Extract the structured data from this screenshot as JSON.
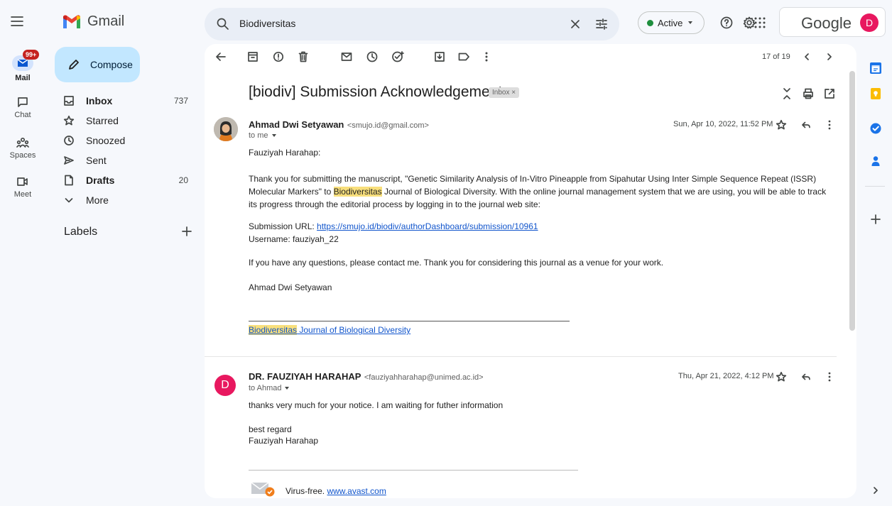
{
  "app": {
    "name": "Gmail"
  },
  "search": {
    "query": "Biodiversitas"
  },
  "status": {
    "label": "Active"
  },
  "account": {
    "brand": "Google",
    "initial": "D"
  },
  "rail": {
    "badge": "99+",
    "items": [
      {
        "label": "Mail"
      },
      {
        "label": "Chat"
      },
      {
        "label": "Spaces"
      },
      {
        "label": "Meet"
      }
    ]
  },
  "sidebar": {
    "compose": "Compose",
    "items": [
      {
        "label": "Inbox",
        "count": "737"
      },
      {
        "label": "Starred",
        "count": ""
      },
      {
        "label": "Snoozed",
        "count": ""
      },
      {
        "label": "Sent",
        "count": ""
      },
      {
        "label": "Drafts",
        "count": "20"
      },
      {
        "label": "More",
        "count": ""
      }
    ],
    "labels_title": "Labels"
  },
  "toolbar": {
    "page_count": "17 of 19"
  },
  "thread": {
    "subject": "[biodiv] Submission Acknowledgement",
    "chip": "Inbox ×",
    "messages": [
      {
        "sender": "Ahmad Dwi Setyawan",
        "email": "<smujo.id@gmail.com>",
        "to": "to me",
        "date": "Sun, Apr 10, 2022, 11:52 PM",
        "greeting": "Fauziyah Harahap:",
        "p1_before": "Thank you for submitting the manuscript, \"Genetic Similarity Analysis of In-Vitro Pineapple from Sipahutar Using Inter Simple Sequence Repeat (ISSR) Molecular Markers\" to ",
        "p1_highlight": "Biodiversitas",
        "p1_after": " Journal of Biological Diversity. With the online journal management system that we are using, you will be able to track its progress through the editorial process by logging in to the journal web site:",
        "url_label": "Submission URL: ",
        "url": "https://smujo.id/biodiv/authorDashboard/submission/10961",
        "username": "Username: fauziyah_22",
        "p2": "If you have any questions, please contact me. Thank you for considering this journal as a venue for your work.",
        "signoff": "Ahmad Dwi Setyawan",
        "footer_highlight": "Biodiversitas",
        "footer_link": " Journal of Biological Diversity"
      },
      {
        "sender": "DR. FAUZIYAH HARAHAP",
        "email": "<fauziyahharahap@unimed.ac.id>",
        "to": "to Ahmad",
        "date": "Thu, Apr 21, 2022, 4:12 PM",
        "avatar": "D",
        "line1": "thanks very much for your notice.  I am waiting for futher information",
        "line2": "best regard",
        "line3": "Fauziyah Harahap",
        "virus_text": "Virus-free. ",
        "virus_link": "www.avast.com"
      }
    ]
  }
}
